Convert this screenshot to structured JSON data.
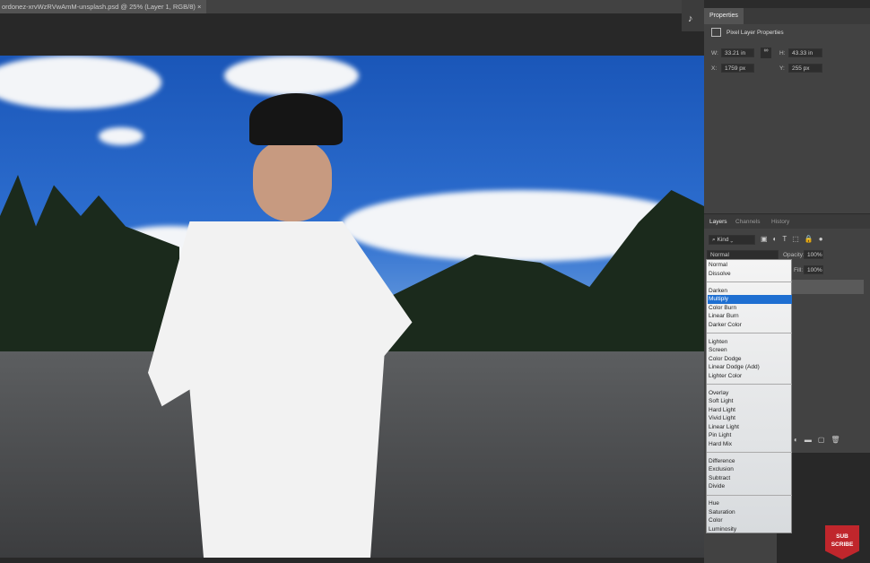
{
  "document": {
    "tab_title": "ordonez-xrvWzRVwAmM-unsplash.psd @ 25% (Layer 1, RGB/8)",
    "tab_close": "×"
  },
  "properties": {
    "tab": "Properties",
    "section": "Pixel Layer Properties",
    "w_label": "W:",
    "w": "33.21 in",
    "h_label": "H:",
    "h": "43.33 in",
    "x_label": "X:",
    "x": "1759 px",
    "y_label": "Y:",
    "y": "255 px"
  },
  "layers": {
    "tabs": [
      "Layers",
      "Channels",
      "History"
    ],
    "filter": "Kind",
    "blend_mode": "Normal",
    "opacity_label": "Opacity:",
    "opacity": "100%",
    "fill_label": "Fill:",
    "fill": "100%"
  },
  "blend_menu": {
    "groups": [
      [
        "Normal",
        "Dissolve"
      ],
      [
        "Darken",
        "Multiply",
        "Color Burn",
        "Linear Burn",
        "Darker Color"
      ],
      [
        "Lighten",
        "Screen",
        "Color Dodge",
        "Linear Dodge (Add)",
        "Lighter Color"
      ],
      [
        "Overlay",
        "Soft Light",
        "Hard Light",
        "Vivid Light",
        "Linear Light",
        "Pin Light",
        "Hard Mix"
      ],
      [
        "Difference",
        "Exclusion",
        "Subtract",
        "Divide"
      ],
      [
        "Hue",
        "Saturation",
        "Color",
        "Luminosity"
      ]
    ],
    "highlighted": "Multiply"
  },
  "badge": {
    "line1": "SUB",
    "line2": "SCRIBE"
  }
}
